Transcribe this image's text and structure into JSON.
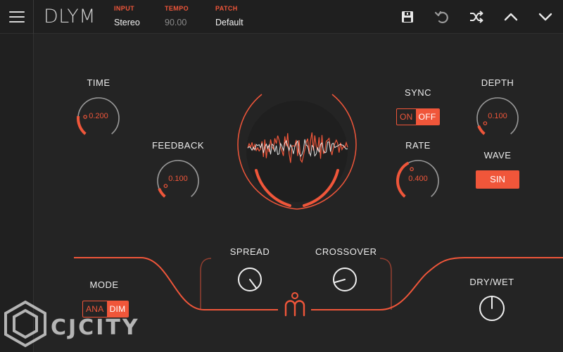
{
  "header": {
    "title": "DLYM",
    "input_label": "INPUT",
    "input_value": "Stereo",
    "tempo_label": "TEMPO",
    "tempo_value": "90.00",
    "patch_label": "PATCH",
    "patch_value": "Default"
  },
  "controls": {
    "time": {
      "label": "TIME",
      "value": "0.200",
      "level": 0.2
    },
    "feedback": {
      "label": "FEEDBACK",
      "value": "0.100",
      "level": 0.1
    },
    "rate": {
      "label": "RATE",
      "value": "0.400",
      "level": 0.4
    },
    "depth": {
      "label": "DEPTH",
      "value": "0.100",
      "level": 0.1
    },
    "sync": {
      "label": "SYNC",
      "on": "ON",
      "off": "OFF",
      "selected": "OFF"
    },
    "wave": {
      "label": "WAVE",
      "value": "SIN"
    },
    "spread": {
      "label": "SPREAD"
    },
    "crossover": {
      "label": "CROSSOVER"
    },
    "mode": {
      "label": "MODE",
      "ana": "ANA",
      "dim": "DIM",
      "selected": "DIM"
    },
    "drywet": {
      "label": "DRY/WET"
    }
  },
  "watermark": {
    "text": "CJCITY"
  },
  "colors": {
    "accent": "#f0563a",
    "background": "#242424",
    "track": "#9a9a9a"
  }
}
